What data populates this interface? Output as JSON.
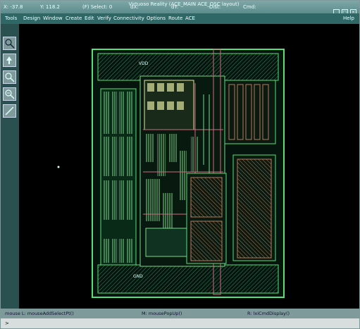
{
  "titlebar": {
    "x_readout": "X: -37.8",
    "y_readout": "Y: 118.2",
    "select_readout": "(F) Select: 0",
    "dx_label": "dX:",
    "dy_label": "dY:",
    "dist_label": "Dist:",
    "cmd_label": "Cmd:",
    "title": "Virtuoso Reality (ACE_MAIN ACE_OSC layout)"
  },
  "menubar": {
    "items": [
      "Tools",
      "Design",
      "Window",
      "Create",
      "Edit",
      "Verify",
      "Connectivity",
      "Options",
      "Route",
      "ACE"
    ],
    "help": "Help"
  },
  "layout": {
    "vdd_label": "VDD",
    "gnd_label": "GND"
  },
  "status": {
    "left": "mouse L: mouseAddSelectPt()",
    "middle": "M: mousePopUp()",
    "right": "R: lxiCmdDisplay()"
  },
  "prompt": {
    "text": ">"
  },
  "colors": {
    "titlebar": "#5c8c8c",
    "menubar": "#2f6666",
    "canvas": "#000000",
    "boundary": "#56e07a",
    "metal": "#7ad88a",
    "poly": "#d06a7e",
    "via": "#e0e6a0",
    "capacitor": "#b47a5a"
  }
}
